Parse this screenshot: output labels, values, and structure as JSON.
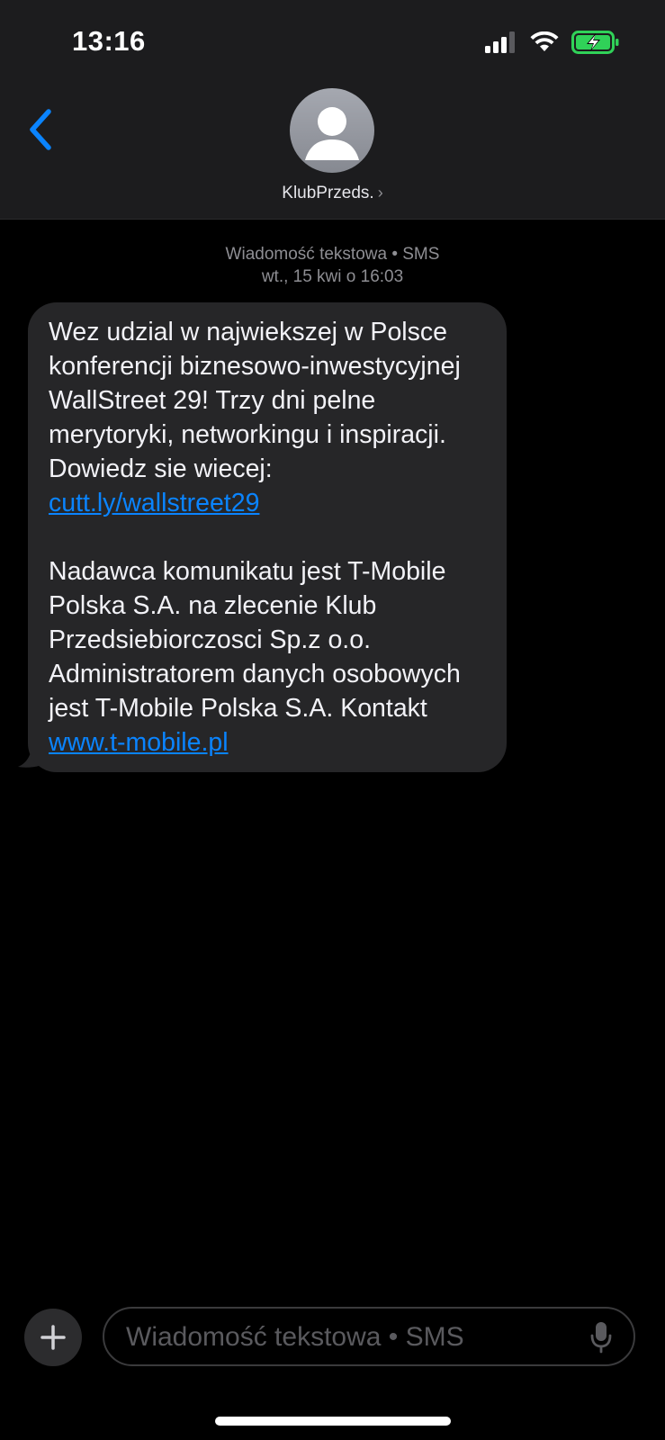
{
  "status_bar": {
    "time": "13:16",
    "icons": [
      "cellular-signal-icon",
      "wifi-icon",
      "battery-charging-icon"
    ]
  },
  "header": {
    "back_icon": "chevron-left-icon",
    "avatar_icon": "person-silhouette-icon",
    "contact_name": "KlubPrzeds.",
    "contact_chevron": "›"
  },
  "conversation": {
    "meta_line1": "Wiadomość tekstowa • SMS",
    "meta_line2": "wt., 15 kwi o 16:03",
    "message": {
      "para1_text": "Wez udzial w najwiekszej w Polsce konferencji biznesowo-inwestycyjnej WallStreet 29! Trzy dni pelne merytoryki, networkingu i inspiracji. Dowiedz sie wiecej: ",
      "para1_link": "cutt.ly/wallstreet29",
      "para2_text": "Nadawca komunikatu jest T-Mobile Polska S.A. na zlecenie Klub Przedsiebiorczosci Sp.z o.o. Administratorem danych osobowych jest T-Mobile Polska S.A. Kontakt ",
      "para2_link": "www.t-mobile.pl"
    }
  },
  "composer": {
    "plus_icon": "plus-icon",
    "placeholder": "Wiadomość tekstowa • SMS",
    "value": "",
    "mic_icon": "microphone-icon"
  },
  "colors": {
    "accent": "#0a84ff",
    "bubble": "#262628",
    "header_bg": "#1c1c1e",
    "battery": "#30d158"
  }
}
